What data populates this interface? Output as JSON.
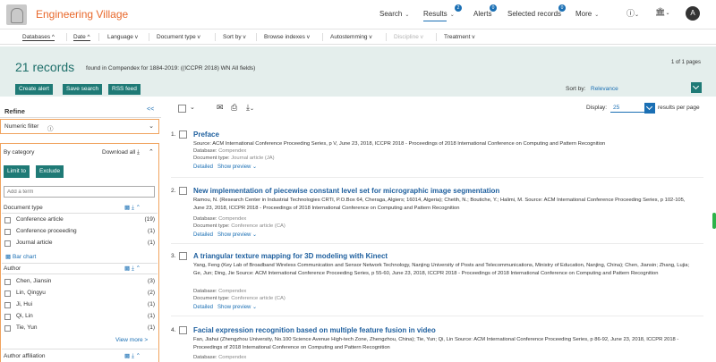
{
  "brand": {
    "name": "Engineering Village",
    "logo": "elsevier-tree-logo"
  },
  "nav": {
    "search": "Search",
    "results": "Results",
    "results_badge": "2",
    "alerts": "Alerts",
    "alerts_badge": "0",
    "selected": "Selected records",
    "selected_badge": "0",
    "more": "More",
    "avatar": "A",
    "help_icon": "help-icon",
    "library_icon": "library-icon"
  },
  "filters": [
    {
      "label": "Databases",
      "caret": "^"
    },
    {
      "label": "Date",
      "caret": "^"
    },
    {
      "label": "Language",
      "caret": "v"
    },
    {
      "label": "Document type",
      "caret": "v"
    },
    {
      "label": "Sort by",
      "caret": "v"
    },
    {
      "label": "Browse indexes",
      "caret": "v"
    },
    {
      "label": "Autostemming",
      "caret": "v"
    },
    {
      "label": "Discipline",
      "caret": "v"
    },
    {
      "label": "Treatment",
      "caret": "v"
    }
  ],
  "results_header": {
    "count": "21 records",
    "found": "found in Compendex for 1884-2019: ((ICCPR 2018) WN All fields)",
    "pages": "1 of 1 pages",
    "create_alert": "Create alert",
    "save_search": "Save search",
    "rss": "RSS feed",
    "sort_label": "Sort by:",
    "sort_value": "Relevance"
  },
  "refine": {
    "title": "Refine",
    "collapse": "<<",
    "numeric_filter": "Numeric filter",
    "by_category": "By category",
    "download_all": "Download all",
    "limit_to": "Limit to",
    "exclude": "Exclude",
    "add_term_placeholder": "Add a term",
    "doc_type_label": "Document type",
    "doc_types": [
      {
        "name": "Conference article",
        "count": "(19)"
      },
      {
        "name": "Conference proceeding",
        "count": "(1)"
      },
      {
        "name": "Journal article",
        "count": "(1)"
      }
    ],
    "bar_chart": "Bar chart",
    "author_label": "Author",
    "authors": [
      {
        "name": "Chen, Jiansin",
        "count": "(3)"
      },
      {
        "name": "Lin, Qingyu",
        "count": "(2)"
      },
      {
        "name": "Ji, Hui",
        "count": "(1)"
      },
      {
        "name": "Qi, Lin",
        "count": "(1)"
      },
      {
        "name": "Tie, Yun",
        "count": "(1)"
      }
    ],
    "view_more": "View more >",
    "author_affiliation": "Author affiliation"
  },
  "display": {
    "label": "Display:",
    "value": "25",
    "suffix": "results per page"
  },
  "results": [
    {
      "num": "1.",
      "title": "Preface",
      "source": "Source: ACM International Conference Proceeding Series, p V, June 23, 2018, ICCPR 2018 - Proceedings of 2018 International Conference on Computing and Pattern Recognition",
      "database": "Compendex",
      "doctype": "Journal article (JA)"
    },
    {
      "num": "2.",
      "title": "New implementation of piecewise constant level set for micrographic image segmentation",
      "source": "Ramou, N. (Research Center in Industrial Technologies CRTI, P.O.Box 64, Cheraga, Algiers; 16014, Algeria); Chetih, N.; Boutiche, Y.; Halimi, M. Source: ACM International Conference Proceeding Series, p 102-105, June 23, 2018, ICCPR 2018 - Proceedings of 2018 International Conference on Computing and Pattern Recognition",
      "database": "Compendex",
      "doctype": "Conference article (CA)"
    },
    {
      "num": "3.",
      "title": "A triangular texture mapping for 3D modeling with Kinect",
      "source": "Yang, Feng (Key Lab of Broadband Wireless Communication and Sensor Network Technology, Nanjing University of Posts and Telecommunications, Ministry of Education, Nanjing, China); Chen, Jiansin; Zhang, Lujia; Ge, Jun; Ding, Jie Source: ACM International Conference Proceeding Series, p 55-60, June 23, 2018, ICCPR 2018 - Proceedings of 2018 International Conference on Computing and Pattern Recognition",
      "database": "Compendex",
      "doctype": "Conference article (CA)"
    },
    {
      "num": "4.",
      "title": "Facial expression recognition based on multiple feature fusion in video",
      "source": "Fan, Jiahui (Zhengzhou University, No.100 Science Avenue High-tech Zone, Zhengzhou, China); Tie, Yun; Qi, Lin Source: ACM International Conference Proceeding Series, p 86-92, June 23, 2018, ICCPR 2018 - Proceedings of 2018 International Conference on Computing and Pattern Recognition",
      "database": "Compendex"
    }
  ],
  "labels": {
    "database": "Database:",
    "doctype": "Document type:",
    "detailed": "Detailed",
    "preview": "Show preview"
  }
}
